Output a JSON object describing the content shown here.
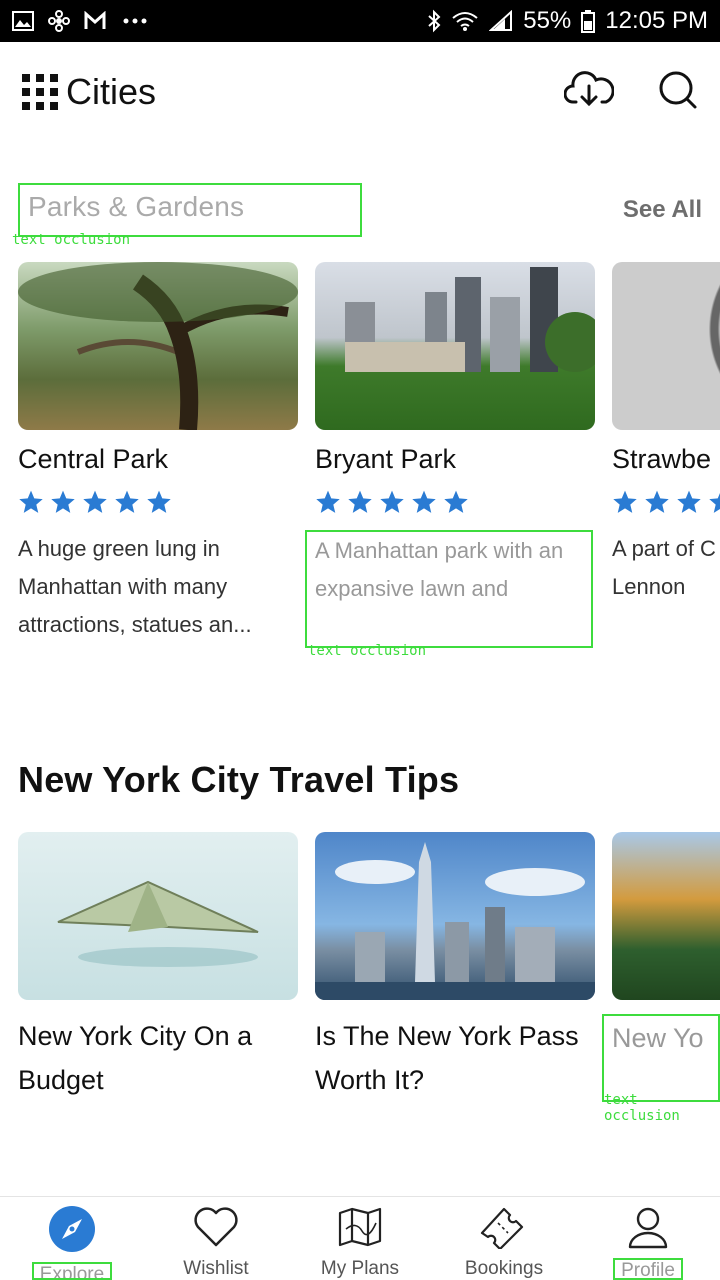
{
  "status_bar": {
    "battery": "55%",
    "time": "12:05 PM",
    "left_icons": [
      "image-icon",
      "pinwheel-icon",
      "gmail-icon",
      "more-icon"
    ],
    "right_icons": [
      "bluetooth-icon",
      "wifi-icon",
      "signal-icon",
      "battery-icon"
    ]
  },
  "app_bar": {
    "title": "Cities",
    "actions": [
      "download-cloud-icon",
      "search-icon"
    ]
  },
  "sections": {
    "parks": {
      "title": "Parks & Gardens",
      "see_all": "See All",
      "occlusion_note": "text occlusion",
      "cards": [
        {
          "title": "Central Park",
          "rating": 5,
          "description": "A huge green lung in Manhattan with many attractions, statues an..."
        },
        {
          "title": "Bryant Park",
          "rating": 5,
          "description": "A Manhattan park with an expansive lawn and",
          "occlusion_note": "text occlusion"
        },
        {
          "title": "Strawbe",
          "rating": 5,
          "description": "A part of C dedicated Lennon"
        }
      ]
    },
    "tips": {
      "title": "New York City Travel Tips",
      "cards": [
        {
          "title": "New York City On a Budget"
        },
        {
          "title": "Is The New York Pass Worth It?"
        },
        {
          "title": "New Yo",
          "occlusion_note": "text occlusion"
        }
      ]
    }
  },
  "bottom_nav": {
    "items": [
      {
        "label": "Explore",
        "icon": "compass-icon",
        "active": true
      },
      {
        "label": "Wishlist",
        "icon": "heart-icon",
        "active": false
      },
      {
        "label": "My Plans",
        "icon": "map-icon",
        "active": false
      },
      {
        "label": "Bookings",
        "icon": "ticket-icon",
        "active": false
      },
      {
        "label": "Profile",
        "icon": "person-icon",
        "active": false
      }
    ]
  },
  "colors": {
    "accent": "#2a7bd3",
    "star": "#2a7bd3",
    "occlusion_box": "#3ddc3d",
    "see_all": "#6e6e6e"
  }
}
